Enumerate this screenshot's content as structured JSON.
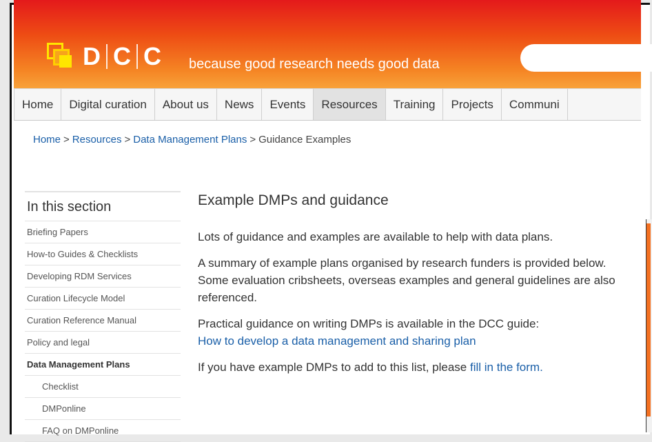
{
  "header": {
    "logo_letters": [
      "D",
      "C",
      "C"
    ],
    "tagline": "because good research needs good data",
    "gradient_top": "#e4191b",
    "gradient_bottom": "#f8a23a",
    "logo_accent": "#ffe600"
  },
  "nav": {
    "items": [
      {
        "label": "Home"
      },
      {
        "label": "Digital curation"
      },
      {
        "label": "About us"
      },
      {
        "label": "News"
      },
      {
        "label": "Events"
      },
      {
        "label": "Resources",
        "active": true
      },
      {
        "label": "Training"
      },
      {
        "label": "Projects"
      },
      {
        "label": "Communi"
      }
    ]
  },
  "breadcrumb": {
    "items": [
      "Home",
      "Resources",
      "Data Management Plans"
    ],
    "separator": ">",
    "current": "Guidance Examples"
  },
  "sidebar": {
    "title": "In this section",
    "items": [
      {
        "label": "Briefing Papers"
      },
      {
        "label": "How-to Guides & Checklists"
      },
      {
        "label": "Developing RDM Services"
      },
      {
        "label": "Curation Lifecycle Model"
      },
      {
        "label": "Curation Reference Manual"
      },
      {
        "label": "Policy and legal"
      },
      {
        "label": "Data Management Plans",
        "bold": true
      },
      {
        "label": "Checklist",
        "sub": true
      },
      {
        "label": "DMPonline",
        "sub": true
      },
      {
        "label": "FAQ on DMPonline",
        "sub": true
      }
    ]
  },
  "main": {
    "title": "Example DMPs and guidance",
    "p1": "Lots of guidance and examples are available to help with data plans.",
    "p2": "A summary of example plans organised by research funders is provided below. Some evaluation cribsheets, overseas examples and general guidelines are also referenced.",
    "p3_text": "Practical guidance on writing DMPs is available in the DCC guide:",
    "p3_link": "How to develop a data management and sharing plan",
    "p4_text": "If you have example DMPs to add to this list, please ",
    "p4_link": "fill in the form."
  },
  "colors": {
    "link": "#1a5fa8",
    "nav_active": "#e2e2e2",
    "right_tab": "#f37021"
  }
}
